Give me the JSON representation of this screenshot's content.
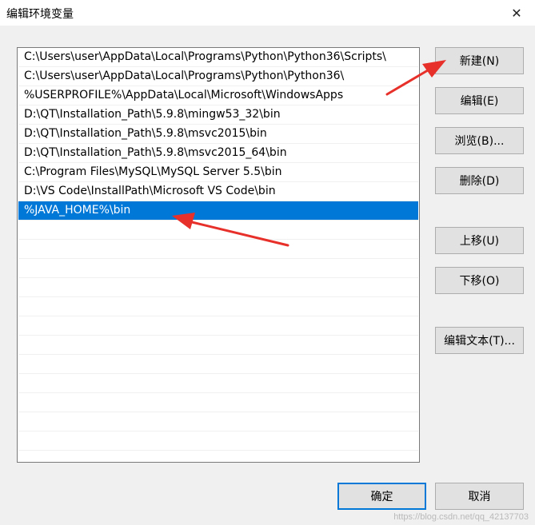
{
  "window": {
    "title": "编辑环境变量",
    "close_glyph": "✕"
  },
  "paths": [
    "C:\\Users\\user\\AppData\\Local\\Programs\\Python\\Python36\\Scripts\\",
    "C:\\Users\\user\\AppData\\Local\\Programs\\Python\\Python36\\",
    "%USERPROFILE%\\AppData\\Local\\Microsoft\\WindowsApps",
    "D:\\QT\\Installation_Path\\5.9.8\\mingw53_32\\bin",
    "D:\\QT\\Installation_Path\\5.9.8\\msvc2015\\bin",
    "D:\\QT\\Installation_Path\\5.9.8\\msvc2015_64\\bin",
    "C:\\Program Files\\MySQL\\MySQL Server 5.5\\bin",
    "D:\\VS Code\\InstallPath\\Microsoft VS Code\\bin",
    "%JAVA_HOME%\\bin"
  ],
  "buttons": {
    "new": "新建(N)",
    "edit": "编辑(E)",
    "browse": "浏览(B)...",
    "delete": "删除(D)",
    "move_up": "上移(U)",
    "move_down": "下移(O)",
    "edit_text": "编辑文本(T)...",
    "ok": "确定",
    "cancel": "取消"
  },
  "colors": {
    "selection": "#0078d7",
    "annotation_arrow": "#e8302a"
  },
  "watermark": "https://blog.csdn.net/qq_42137703"
}
